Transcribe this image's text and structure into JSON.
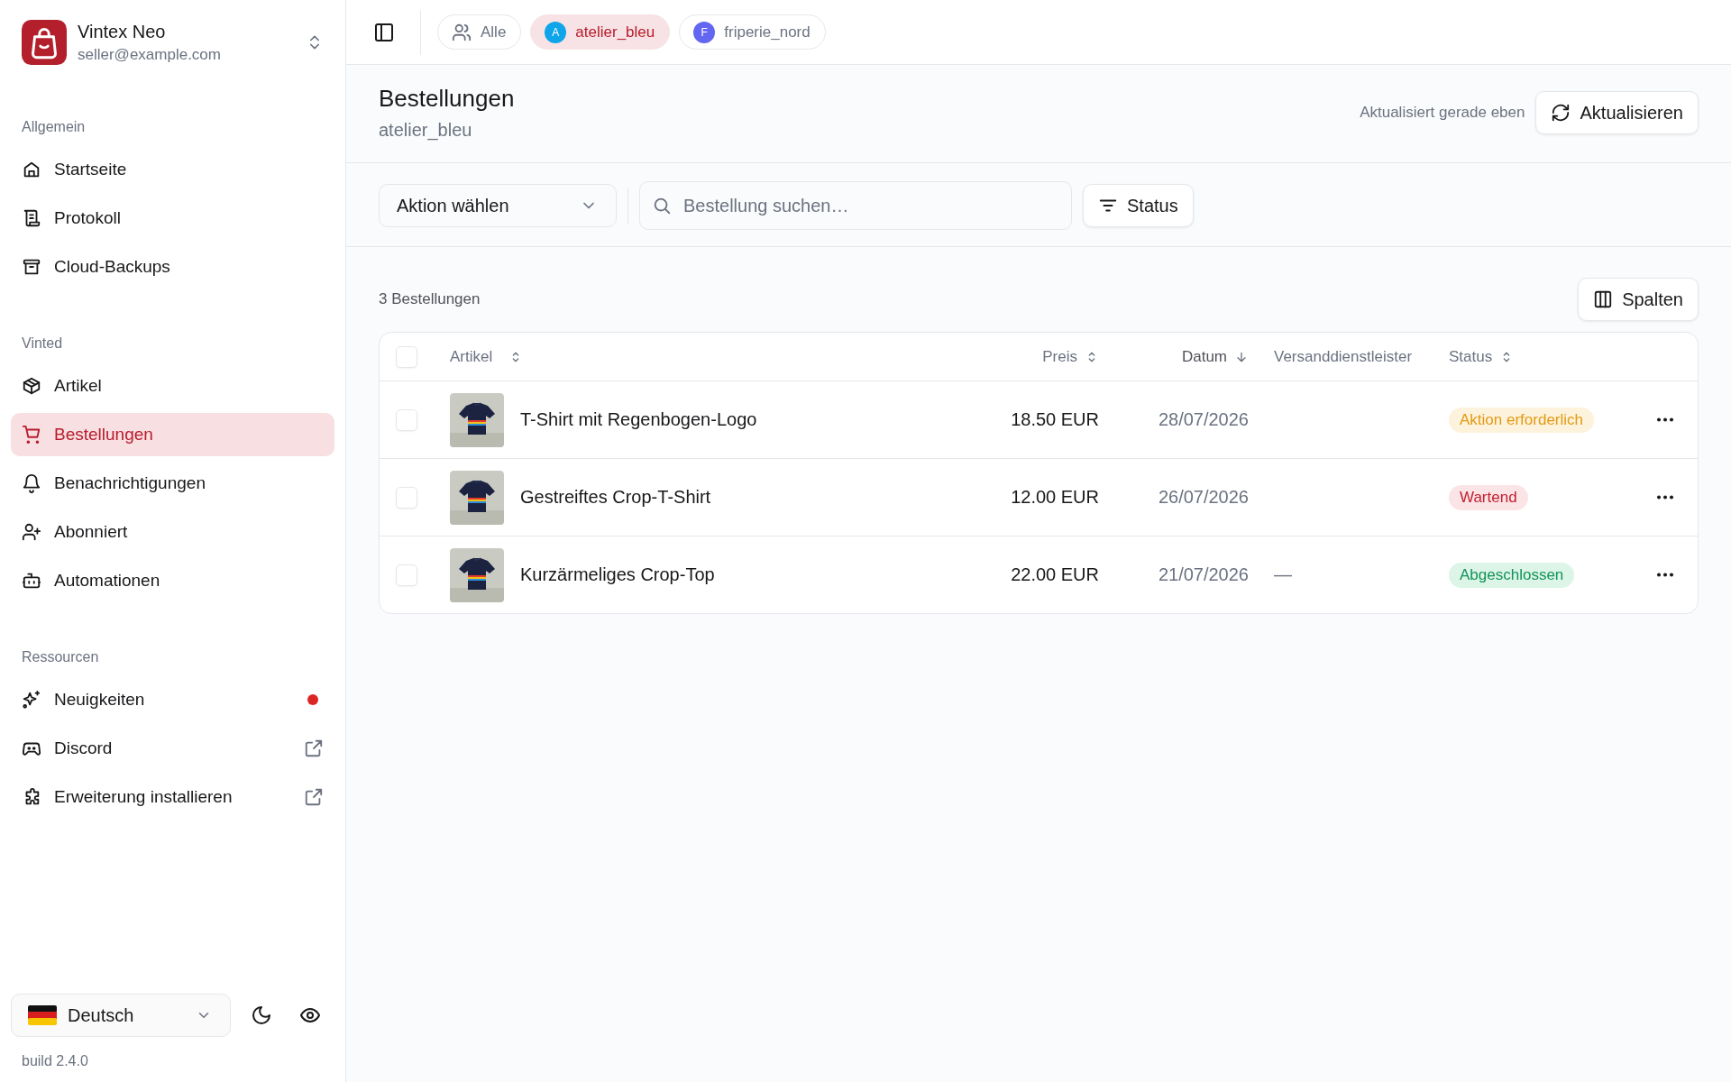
{
  "account": {
    "name": "Vintex Neo",
    "email": "seller@example.com"
  },
  "sidebar": {
    "sections": [
      {
        "title": "Allgemein",
        "items": [
          {
            "label": "Startseite",
            "selected": false
          },
          {
            "label": "Protokoll",
            "selected": false
          },
          {
            "label": "Cloud-Backups",
            "selected": false
          }
        ]
      },
      {
        "title": "Vinted",
        "items": [
          {
            "label": "Artikel",
            "selected": false
          },
          {
            "label": "Bestellungen",
            "selected": true
          },
          {
            "label": "Benachrichtigungen",
            "selected": false
          },
          {
            "label": "Abonniert",
            "selected": false
          },
          {
            "label": "Automationen",
            "selected": false
          }
        ]
      },
      {
        "title": "Ressourcen",
        "items": [
          {
            "label": "Neuigkeiten",
            "selected": false,
            "unread": true
          },
          {
            "label": "Discord",
            "selected": false,
            "external": true
          },
          {
            "label": "Erweiterung installieren",
            "selected": false,
            "external": true
          }
        ]
      }
    ],
    "language": "Deutsch",
    "build": "build 2.4.0"
  },
  "account_tabs": [
    {
      "kind": "all",
      "label": "Alle",
      "selected": false
    },
    {
      "kind": "account",
      "initial": "A",
      "label": "atelier_bleu",
      "color": "#0ea5e9",
      "selected": true
    },
    {
      "kind": "account",
      "initial": "F",
      "label": "friperie_nord",
      "color": "#6366f1",
      "selected": false
    }
  ],
  "page": {
    "title": "Bestellungen",
    "subtitle": "atelier_bleu",
    "updated": "Aktualisiert gerade eben",
    "refresh_button": "Aktualisieren"
  },
  "toolbar": {
    "action_select": "Aktion wählen",
    "search": {
      "placeholder": "Bestellung suchen…"
    },
    "status_button": "Status"
  },
  "count": "3 Bestellungen",
  "columns_button": "Spalten",
  "table": {
    "all_checked": false,
    "columns": [
      {
        "label": "Artikel",
        "sortable": true,
        "sorted_desc": false
      },
      {
        "label": "Preis",
        "sortable": true,
        "sorted_desc": false
      },
      {
        "label": "Datum",
        "sortable": true,
        "sorted_desc": true
      },
      {
        "label": "Versanddienstleister"
      },
      {
        "label": "Status",
        "sortable": true,
        "sorted_desc": false
      }
    ],
    "rows": [
      {
        "checked": false,
        "item": "T-Shirt mit Regenbogen-Logo",
        "price": "18.50 EUR",
        "date": "28/07/2026",
        "status": {
          "kind": "warning",
          "label": "Aktion erforderlich"
        }
      },
      {
        "checked": false,
        "item": "Gestreiftes Crop-T-Shirt",
        "price": "12.00 EUR",
        "date": "26/07/2026",
        "status": {
          "kind": "danger",
          "label": "Wartend"
        }
      },
      {
        "checked": false,
        "item": "Kurzärmeliges Crop-Top",
        "price": "22.00 EUR",
        "date": "21/07/2026",
        "carrier": "—",
        "status": {
          "kind": "success",
          "label": "Abgeschlossen"
        }
      }
    ]
  }
}
